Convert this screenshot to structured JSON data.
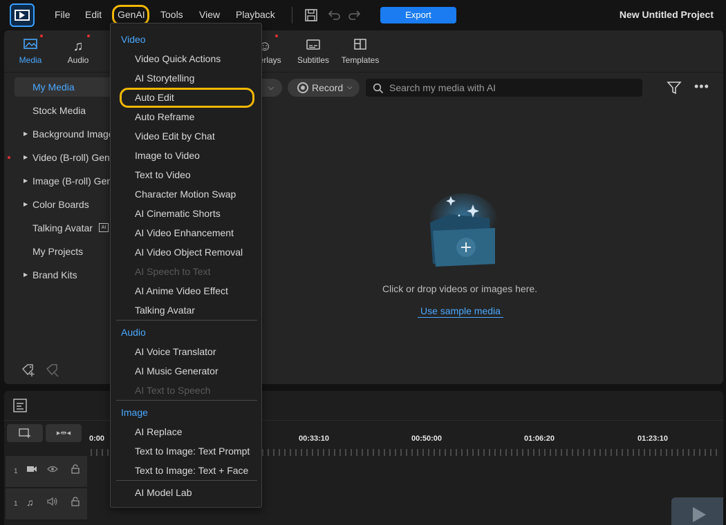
{
  "menubar": {
    "items": [
      "File",
      "Edit",
      "GenAI",
      "Tools",
      "View",
      "Playback"
    ],
    "export_label": "Export",
    "project_title": "New Untitled Project"
  },
  "library": {
    "tabs": [
      {
        "label": "Media",
        "icon": "media-icon",
        "active": true
      },
      {
        "label": "Audio",
        "icon": "music-note-icon",
        "active": false
      },
      {
        "label": "Overlays",
        "icon": "sticker-icon",
        "active": false
      },
      {
        "label": "Subtitles",
        "icon": "subtitles-icon",
        "active": false
      },
      {
        "label": "Templates",
        "icon": "templates-icon",
        "active": false
      }
    ],
    "sidebar": [
      {
        "label": "My Media",
        "selected": true,
        "expandable": false
      },
      {
        "label": "Stock Media",
        "selected": false,
        "expandable": false
      },
      {
        "label": "Background Images",
        "selected": false,
        "expandable": true
      },
      {
        "label": "Video (B-roll) Generator",
        "selected": false,
        "expandable": true
      },
      {
        "label": "Image (B-roll) Generator",
        "selected": false,
        "expandable": true
      },
      {
        "label": "Color Boards",
        "selected": false,
        "expandable": true
      },
      {
        "label": "Talking Avatar",
        "selected": false,
        "expandable": false
      },
      {
        "label": "My Projects",
        "selected": false,
        "expandable": false
      },
      {
        "label": "Brand Kits",
        "selected": false,
        "expandable": true
      }
    ],
    "record_label": "Record",
    "search_placeholder": "Search my media with AI",
    "drop_text": "Click or drop videos or images here.",
    "sample_link": "Use sample media"
  },
  "timeline": {
    "timecodes": [
      "0:00",
      "00:33:10",
      "00:50:00",
      "01:06:20",
      "01:23:10"
    ],
    "tracks": [
      {
        "number": "1",
        "type": "video"
      },
      {
        "number": "1",
        "type": "audio"
      }
    ]
  },
  "genai_menu": {
    "sections": [
      {
        "title": "Video",
        "items": [
          {
            "label": "Video Quick Actions",
            "disabled": false
          },
          {
            "label": "AI Storytelling",
            "disabled": false
          },
          {
            "label": "Auto Edit",
            "disabled": false,
            "highlighted": true
          },
          {
            "label": "Auto Reframe",
            "disabled": false
          },
          {
            "label": "Video Edit by Chat",
            "disabled": false
          },
          {
            "label": "Image to Video",
            "disabled": false
          },
          {
            "label": "Text to Video",
            "disabled": false
          },
          {
            "label": "Character Motion Swap",
            "disabled": false
          },
          {
            "label": "AI Cinematic Shorts",
            "disabled": false
          },
          {
            "label": "AI Video Enhancement",
            "disabled": false
          },
          {
            "label": "AI Video Object Removal",
            "disabled": false
          },
          {
            "label": "AI Speech to Text",
            "disabled": true
          },
          {
            "label": "AI Anime Video Effect",
            "disabled": false
          },
          {
            "label": "Talking Avatar",
            "disabled": false
          }
        ]
      },
      {
        "title": "Audio",
        "items": [
          {
            "label": "AI Voice Translator",
            "disabled": false
          },
          {
            "label": "AI Music Generator",
            "disabled": false
          },
          {
            "label": "AI Text to Speech",
            "disabled": true
          }
        ]
      },
      {
        "title": "Image",
        "items": [
          {
            "label": "AI Replace",
            "disabled": false
          },
          {
            "label": "Text to Image: Text Prompt",
            "disabled": false
          },
          {
            "label": "Text to Image: Text + Face",
            "disabled": false
          }
        ]
      }
    ],
    "footer_item": "AI Model Lab"
  }
}
